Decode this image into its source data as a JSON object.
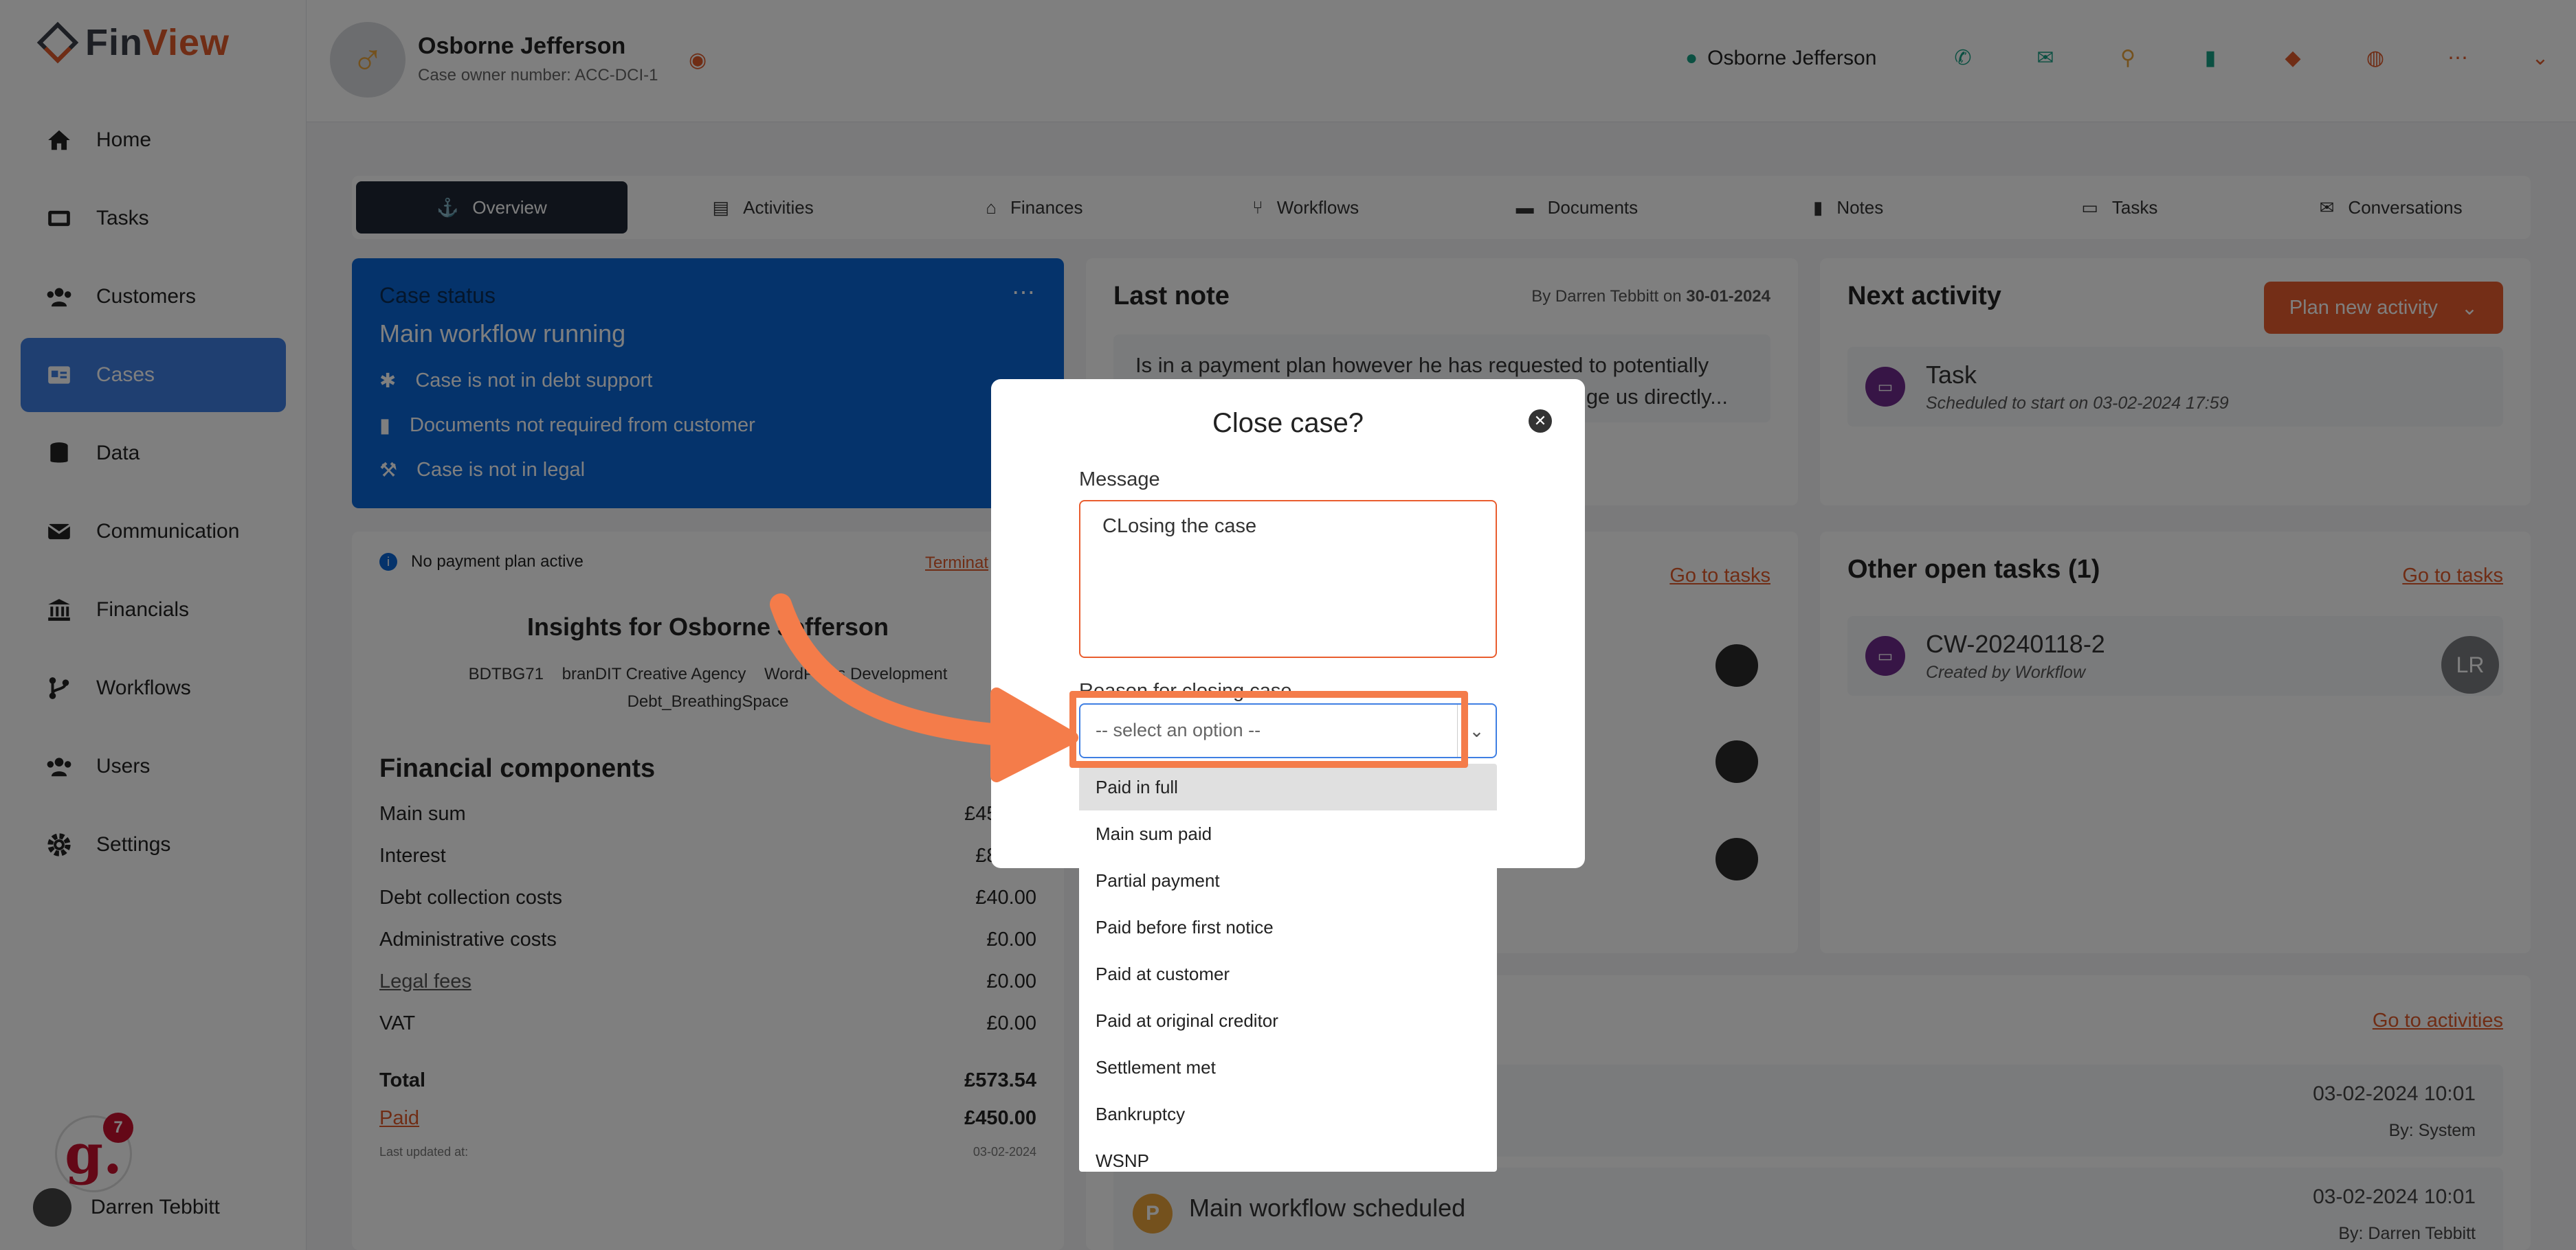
{
  "app": {
    "brand_left": "Fin",
    "brand_right": "View"
  },
  "sidebar": {
    "items": [
      {
        "label": "Home",
        "icon": "home-icon"
      },
      {
        "label": "Tasks",
        "icon": "tasks-icon"
      },
      {
        "label": "Customers",
        "icon": "customers-icon"
      },
      {
        "label": "Cases",
        "icon": "cases-icon",
        "active": true
      },
      {
        "label": "Data",
        "icon": "database-icon"
      },
      {
        "label": "Communication",
        "icon": "envelope-icon"
      },
      {
        "label": "Financials",
        "icon": "bank-icon"
      },
      {
        "label": "Workflows",
        "icon": "branch-icon"
      },
      {
        "label": "Users",
        "icon": "users-icon"
      },
      {
        "label": "Settings",
        "icon": "gear-icon"
      }
    ],
    "user_name": "Darren Tebbitt",
    "notification_count": "7"
  },
  "header": {
    "case_name": "Osborne Jefferson",
    "case_number": "Case owner number: ACC-DCI-1",
    "user": "Osborne Jefferson"
  },
  "tabs": [
    "Overview",
    "Activities",
    "Finances",
    "Workflows",
    "Documents",
    "Notes",
    "Tasks",
    "Conversations"
  ],
  "case_status": {
    "title": "Case status",
    "headline": "Main workflow running",
    "items": [
      "Case is not in debt support",
      "Documents not required from customer",
      "Case is not in legal"
    ]
  },
  "last_note": {
    "title": "Last note",
    "by_prefix": "By Darren Tebbitt on",
    "date": "30-01-2024",
    "body_line1": "Is in a payment plan however he has requested to potentially",
    "body_line2": "ge us directly..."
  },
  "next_activity": {
    "title": "Next activity",
    "plan_button": "Plan new activity",
    "task_title": "Task",
    "task_sub": "Scheduled to start on 03-02-2024 17:59"
  },
  "payment": {
    "status": "No payment plan active",
    "terminate": "Terminat",
    "insights_title": "Insights for Osborne Jefferson",
    "tags_line1": "BDTBG71    branDIT Creative Agency    WordPress Development",
    "tags_line2": "Debt_BreathingSpace",
    "fin_title": "Financial components",
    "rows": [
      {
        "label": "Main sum",
        "value": "£450.00"
      },
      {
        "label": "Interest",
        "value": "£83.54"
      },
      {
        "label": "Debt collection costs",
        "value": "£40.00"
      },
      {
        "label": "Administrative costs",
        "value": "£0.00"
      },
      {
        "label": "Legal fees",
        "value": "£0.00"
      },
      {
        "label": "VAT",
        "value": "£0.00"
      }
    ],
    "total_label": "Total",
    "total_value": "£573.54",
    "paid_label": "Paid",
    "paid_value": "£450.00",
    "updated_label": "Last updated at:",
    "updated_value": "03-02-2024"
  },
  "tasks_card": {
    "go_link": "Go to tasks"
  },
  "other_tasks": {
    "title": "Other open tasks (1)",
    "go_link": "Go to tasks",
    "task_title": "CW-20240118-2",
    "task_sub": "Created by Workflow",
    "assignee": "LR"
  },
  "activities": {
    "go_link": "Go to activities",
    "items": [
      {
        "title": "",
        "date": "03-02-2024 10:01",
        "by": "By: System"
      },
      {
        "title": "Main workflow scheduled",
        "date": "03-02-2024 10:01",
        "by": "By: Darren Tebbitt"
      }
    ]
  },
  "modal": {
    "title": "Close case?",
    "message_label": "Message",
    "message_value": "CLosing the case",
    "reason_label": "Reason for closing case",
    "select_placeholder": "-- select an option --",
    "options": [
      "Paid in full",
      "Main sum paid",
      "Partial payment",
      "Paid before first notice",
      "Paid at customer",
      "Paid at original creditor",
      "Settlement met",
      "Bankruptcy",
      "WSNP"
    ]
  },
  "colors": {
    "accent": "#e95d2e",
    "primary": "#0b66d6",
    "highlight": "#f47c4a"
  }
}
